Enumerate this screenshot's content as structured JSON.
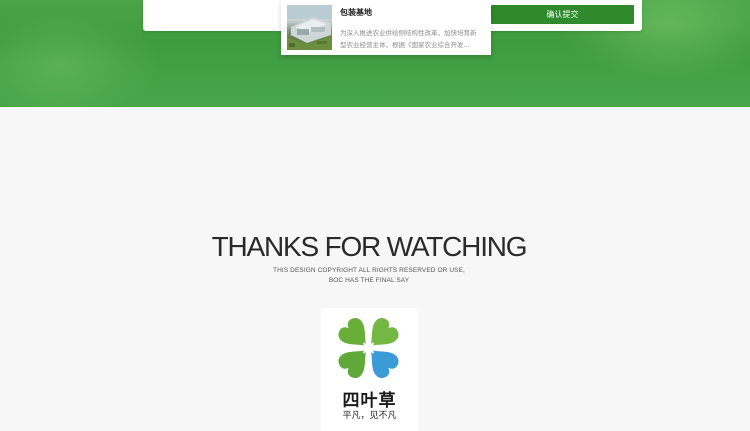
{
  "form": {
    "submit_label": "确认提交"
  },
  "news": {
    "title": "包装基地",
    "description": "为深入推进农业供给侧结构性改革，加快培育新型农业经营主体，根据《国家农业综合开发..."
  },
  "closing": {
    "title": "THANKS FOR WATCHING",
    "copyright_line1": "THIS DESIGN COPYRIGHT ALL RIGHTS RESERVED OR USE,",
    "copyright_line2": "BOC HAS THE FINAL SAY"
  },
  "logo": {
    "name": "四叶草",
    "slogan": "平凡，见不凡"
  },
  "colors": {
    "brand_green": "#3f9c3f",
    "button_green": "#2f8a2c",
    "leaf_green": "#6db33f",
    "leaf_blue": "#3a9ad9"
  },
  "icons": {
    "logo": "four-leaf-clover-icon"
  }
}
